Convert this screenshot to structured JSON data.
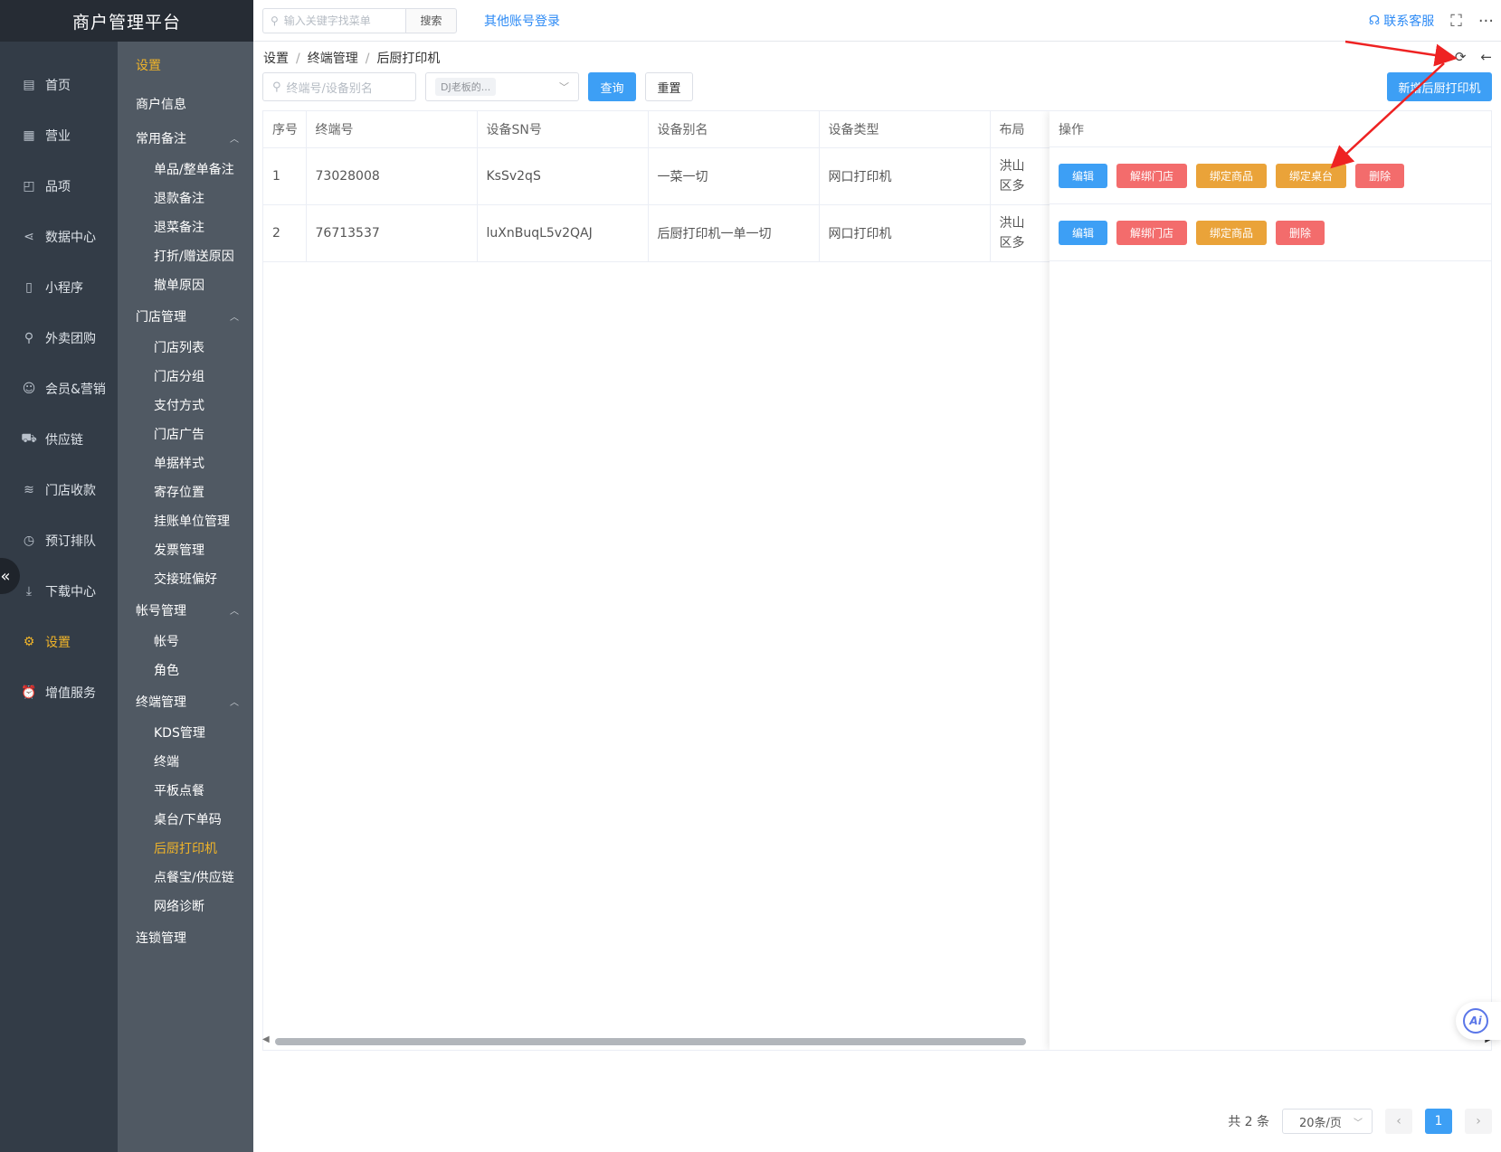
{
  "brand": "商户管理平台",
  "main_menu": [
    {
      "label": "首页",
      "icon": "clipboard-icon"
    },
    {
      "label": "营业",
      "icon": "calendar-icon"
    },
    {
      "label": "品项",
      "icon": "bag-icon"
    },
    {
      "label": "数据中心",
      "icon": "share-icon"
    },
    {
      "label": "小程序",
      "icon": "phone-icon"
    },
    {
      "label": "外卖团购",
      "icon": "bike-icon"
    },
    {
      "label": "会员&营销",
      "icon": "user-icon"
    },
    {
      "label": "供应链",
      "icon": "truck-icon"
    },
    {
      "label": "门店收款",
      "icon": "database-icon"
    },
    {
      "label": "预订排队",
      "icon": "clock-icon"
    },
    {
      "label": "下载中心",
      "icon": "download-icon"
    },
    {
      "label": "设置",
      "icon": "gear-icon",
      "active": true
    },
    {
      "label": "增值服务",
      "icon": "alarm-icon"
    }
  ],
  "sub_menu": {
    "title": "设置",
    "merchant_info": "商户信息",
    "groups": [
      {
        "label": "常用备注",
        "items": [
          "单品/整单备注",
          "退款备注",
          "退菜备注",
          "打折/赠送原因",
          "撤单原因"
        ]
      },
      {
        "label": "门店管理",
        "items": [
          "门店列表",
          "门店分组",
          "支付方式",
          "门店广告",
          "单据样式",
          "寄存位置",
          "挂账单位管理",
          "发票管理",
          "交接班偏好"
        ]
      },
      {
        "label": "帐号管理",
        "items": [
          "帐号",
          "角色"
        ]
      },
      {
        "label": "终端管理",
        "items": [
          "KDS管理",
          "终端",
          "平板点餐",
          "桌台/下单码",
          "后厨打印机",
          "点餐宝/供应链",
          "网络诊断"
        ]
      }
    ],
    "chain": "连锁管理",
    "active_item": "后厨打印机"
  },
  "topbar": {
    "search_placeholder": "输入关键字找菜单",
    "search_btn": "搜索",
    "other_login": "其他账号登录",
    "contact": "联系客服"
  },
  "breadcrumb": [
    "设置",
    "终端管理",
    "后厨打印机"
  ],
  "filters": {
    "terminal_placeholder": "终端号/设备别名",
    "store_tag": "DJ老板的...",
    "query_btn": "查询",
    "reset_btn": "重置",
    "add_btn": "新增后厨打印机"
  },
  "table": {
    "columns": [
      "序号",
      "终端号",
      "设备SN号",
      "设备别名",
      "设备类型",
      "布局",
      "操作"
    ],
    "rows": [
      {
        "no": "1",
        "terminal": "73028008",
        "sn": "KsSv2qS",
        "alias": "一菜一切",
        "type": "网口打印机",
        "layout_top": "洪山",
        "layout_bottom": "区多",
        "ops": [
          "编辑",
          "解绑门店",
          "绑定商品",
          "绑定桌台",
          "删除"
        ]
      },
      {
        "no": "2",
        "terminal": "76713537",
        "sn": "luXnBuqL5v2QAJ",
        "alias": "后厨打印机一单一切",
        "type": "网口打印机",
        "layout_top": "洪山",
        "layout_bottom": "区多",
        "ops": [
          "编辑",
          "解绑门店",
          "绑定商品",
          "删除"
        ]
      }
    ]
  },
  "pagination": {
    "total": "共 2 条",
    "page_size": "20条/页",
    "current": "1"
  },
  "ai_label": "Ai",
  "colors": {
    "accent": "#3d9ff5",
    "active": "#f0b429",
    "danger": "#f36c6c",
    "warning": "#eaa339",
    "annotation": "#ee2222"
  }
}
